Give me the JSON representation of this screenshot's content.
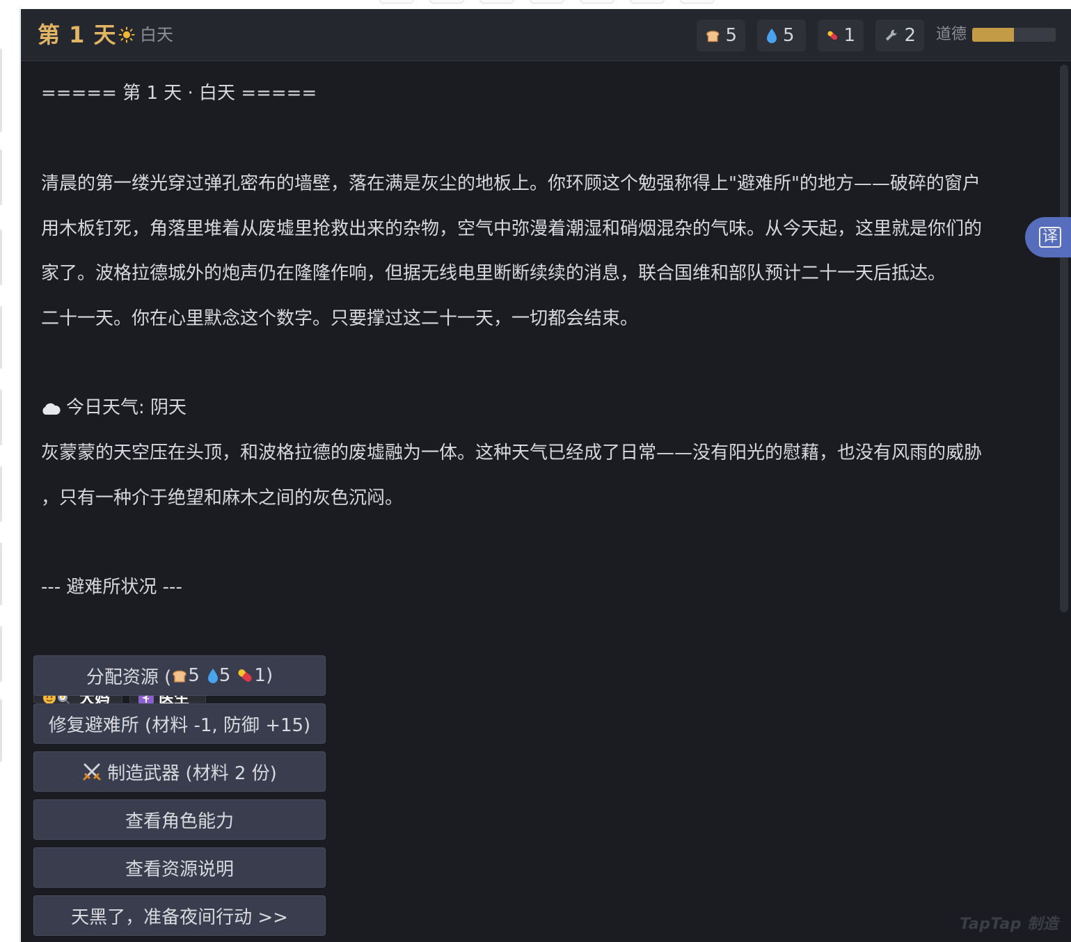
{
  "hud": {
    "day_title": "第 1 天",
    "period": "白天",
    "resources": [
      {
        "icon": "bread-icon",
        "value": "5"
      },
      {
        "icon": "water-drop-icon",
        "value": "5"
      },
      {
        "icon": "pill-icon",
        "value": "1"
      },
      {
        "icon": "wrench-icon",
        "value": "2"
      }
    ],
    "morality_label": "道德",
    "morality_level": 0.5
  },
  "log": {
    "header": "=====  第 1 天  ·  白天  =====",
    "intro_lines": [
      "清晨的第一缕光穿过弹孔密布的墙壁，落在满是灰尘的地板上。你环顾这个勉强称得上\"避难所\"的地方——破碎的窗户",
      "用木板钉死，角落里堆着从废墟里抢救出来的杂物，空气中弥漫着潮湿和硝烟混杂的气味。从今天起，这里就是你们的",
      "家了。波格拉德城外的炮声仍在隆隆作响，但据无线电里断断续续的消息，联合国维和部队预计二十一天后抵达。",
      "二十一天。你在心里默念这个数字。只要撑过这二十一天，一切都会结束。"
    ],
    "weather_label": "今日天气: 阴天",
    "weather_lines": [
      "灰蒙蒙的天空压在头顶，和波格拉德的废墟融为一体。这种天气已经成了日常——没有阳光的慰藉，也没有风雨的威胁",
      "，只有一种介于绝望和麻木之间的灰色沉闷。"
    ],
    "shelter_header": "--- 避难所状况 ---"
  },
  "characters": [
    {
      "name": "大妈",
      "icon": "cook-woman-icon"
    },
    {
      "name": "医生",
      "icon": "medical-icon"
    }
  ],
  "actions": {
    "allocate_prefix": "分配资源 (",
    "allocate_bread": "5",
    "allocate_water": "5",
    "allocate_pill": "1)",
    "repair": "修复避难所 (材料 -1, 防御 +15)",
    "craft": "制造武器 (材料 2 份)",
    "view_abilities": "查看角色能力",
    "view_resources": "查看资源说明",
    "night": "天黑了，准备夜间行动 >>"
  },
  "translate_label": "译",
  "watermark": "TapTap 制造",
  "colors": {
    "background": "#1b1c22",
    "hud": "#25272f",
    "accent_gold": "#e2b465",
    "button": "#3a3d4e",
    "morality_fill": "#c39a45"
  }
}
